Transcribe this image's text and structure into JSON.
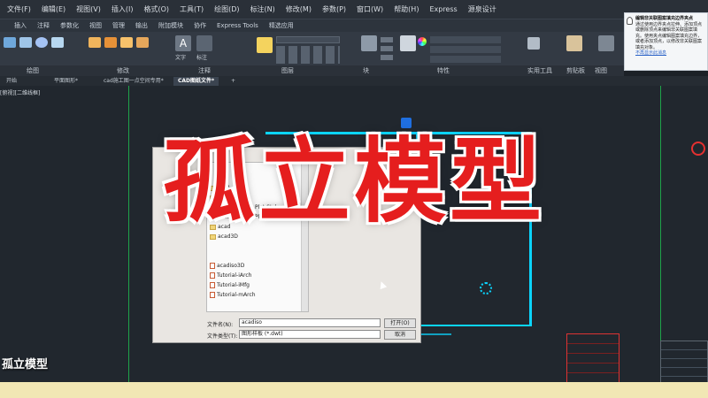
{
  "menubar": {
    "items": [
      "文件(F)",
      "编辑(E)",
      "视图(V)",
      "插入(I)",
      "格式(O)",
      "工具(T)",
      "绘图(D)",
      "标注(N)",
      "修改(M)",
      "参数(P)",
      "窗口(W)",
      "帮助(H)",
      "Express",
      "源泉设计"
    ]
  },
  "ribbon_tabs": [
    "插入",
    "注释",
    "参数化",
    "视图",
    "管理",
    "输出",
    "附加模块",
    "协作",
    "Express Tools",
    "精选应用"
  ],
  "ribbon_panels": [
    "绘图",
    "修改",
    "注释",
    "图层",
    "块",
    "特性",
    "实用工具",
    "剪贴板",
    "视图"
  ],
  "ribbon_labels": {
    "text": "文字",
    "annotation": "标注"
  },
  "doc_tabs": [
    "开始",
    "平面图形*",
    "cad施工图一点空间专用*",
    "CAD图纸文件*"
  ],
  "view_label": "[俯视][二维线框]",
  "notification": {
    "title": "编辑非关联图案填充边界夹点",
    "body": "通过使用边界夹点拉伸、添加顶点或删除顶点来编辑非关联图案填充。使用夹点编辑图案填充边界，或者添加顶点，以修改非关联图案填充对象。",
    "link": "不再显示此消息"
  },
  "dialog": {
    "files": [
      {
        "name": "PTW",
        "type": "folder"
      },
      {
        "name": "SheetSets",
        "type": "folder"
      },
      {
        "name": "acad -Named Plot Styles",
        "type": "folder"
      },
      {
        "name": "acad -Named Plot Styles3D",
        "type": "folder"
      },
      {
        "name": "acad",
        "type": "folder"
      },
      {
        "name": "acad3D",
        "type": "folder"
      },
      {
        "name": "acadiso3D",
        "type": "dwt"
      },
      {
        "name": "Tutorial-iArch",
        "type": "dwt"
      },
      {
        "name": "Tutorial-iMfg",
        "type": "dwt"
      },
      {
        "name": "Tutorial-mArch",
        "type": "dwt"
      }
    ],
    "filename_label": "文件名(N):",
    "filename_value": "acadiso",
    "filetype_label": "文件类型(T):",
    "filetype_value": "图形样板 (*.dwt)",
    "open_button": "打开(O)",
    "cancel_button": "取消"
  },
  "overlay_title": "孤立模型",
  "caption": "孤立模型",
  "accent_red": "#e51e1e",
  "cad_cyan": "#0bd5ff"
}
